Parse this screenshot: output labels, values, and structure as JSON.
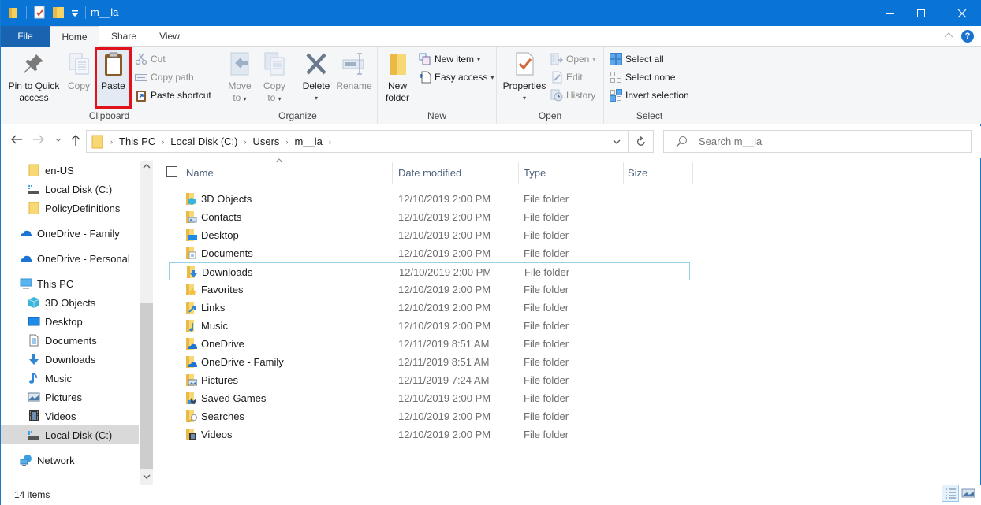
{
  "window": {
    "title": "m__la",
    "controls": {
      "minimize": "—",
      "maximize": "☐",
      "close": "✕"
    }
  },
  "tabs": [
    {
      "label": "File"
    },
    {
      "label": "Home"
    },
    {
      "label": "Share"
    },
    {
      "label": "View"
    }
  ],
  "ribbon": {
    "clipboard": {
      "label": "Clipboard",
      "pin": "Pin to Quick access",
      "pin_l1": "Pin to Quick",
      "pin_l2": "access",
      "copy": "Copy",
      "paste": "Paste",
      "cut": "Cut",
      "copy_path": "Copy path",
      "paste_shortcut": "Paste shortcut"
    },
    "organize": {
      "label": "Organize",
      "move_to_l1": "Move",
      "move_to_l2": "to",
      "copy_to_l1": "Copy",
      "copy_to_l2": "to",
      "delete": "Delete",
      "rename": "Rename"
    },
    "new": {
      "label": "New",
      "new_folder_l1": "New",
      "new_folder_l2": "folder",
      "new_item": "New item",
      "easy_access": "Easy access"
    },
    "open": {
      "label": "Open",
      "properties": "Properties",
      "open": "Open",
      "edit": "Edit",
      "history": "History"
    },
    "select": {
      "label": "Select",
      "select_all": "Select all",
      "select_none": "Select none",
      "invert_selection": "Invert selection"
    }
  },
  "navigation": {
    "breadcrumb": [
      "This PC",
      "Local Disk (C:)",
      "Users",
      "m__la"
    ],
    "search_placeholder": "Search m__la"
  },
  "nav_pane": {
    "items": [
      {
        "label": "en-US",
        "icon": "folder-icon"
      },
      {
        "label": "Local Disk (C:)",
        "icon": "drive-icon"
      },
      {
        "label": "PolicyDefinitions",
        "icon": "folder-icon"
      },
      {
        "label": "OneDrive - Family",
        "icon": "onedrive-icon"
      },
      {
        "label": "OneDrive - Personal",
        "icon": "onedrive-icon"
      },
      {
        "label": "This PC",
        "icon": "this-pc-icon"
      },
      {
        "label": "3D Objects",
        "icon": "3d-objects-icon"
      },
      {
        "label": "Desktop",
        "icon": "desktop-icon"
      },
      {
        "label": "Documents",
        "icon": "documents-icon"
      },
      {
        "label": "Downloads",
        "icon": "downloads-icon"
      },
      {
        "label": "Music",
        "icon": "music-icon"
      },
      {
        "label": "Pictures",
        "icon": "pictures-icon"
      },
      {
        "label": "Videos",
        "icon": "videos-icon"
      },
      {
        "label": "Local Disk (C:)",
        "icon": "drive-icon",
        "selected": true
      },
      {
        "label": "Network",
        "icon": "network-icon"
      }
    ]
  },
  "file_list": {
    "columns": [
      "Name",
      "Date modified",
      "Type",
      "Size"
    ],
    "rows": [
      {
        "name": "3D Objects",
        "date": "12/10/2019 2:00 PM",
        "type": "File folder"
      },
      {
        "name": "Contacts",
        "date": "12/10/2019 2:00 PM",
        "type": "File folder"
      },
      {
        "name": "Desktop",
        "date": "12/10/2019 2:00 PM",
        "type": "File folder"
      },
      {
        "name": "Documents",
        "date": "12/10/2019 2:00 PM",
        "type": "File folder"
      },
      {
        "name": "Downloads",
        "date": "12/10/2019 2:00 PM",
        "type": "File folder",
        "focused": true
      },
      {
        "name": "Favorites",
        "date": "12/10/2019 2:00 PM",
        "type": "File folder"
      },
      {
        "name": "Links",
        "date": "12/10/2019 2:00 PM",
        "type": "File folder"
      },
      {
        "name": "Music",
        "date": "12/10/2019 2:00 PM",
        "type": "File folder"
      },
      {
        "name": "OneDrive",
        "date": "12/11/2019 8:51 AM",
        "type": "File folder"
      },
      {
        "name": "OneDrive - Family",
        "date": "12/11/2019 8:51 AM",
        "type": "File folder"
      },
      {
        "name": "Pictures",
        "date": "12/11/2019 7:24 AM",
        "type": "File folder"
      },
      {
        "name": "Saved Games",
        "date": "12/10/2019 2:00 PM",
        "type": "File folder"
      },
      {
        "name": "Searches",
        "date": "12/10/2019 2:00 PM",
        "type": "File folder"
      },
      {
        "name": "Videos",
        "date": "12/10/2019 2:00 PM",
        "type": "File folder"
      }
    ]
  },
  "status": {
    "item_count": "14 items"
  },
  "colors": {
    "titlebar": "#0a74d6",
    "file_tab": "#1963b0",
    "highlight_box": "#e0121c",
    "folder_yellow": "#f5c342"
  }
}
